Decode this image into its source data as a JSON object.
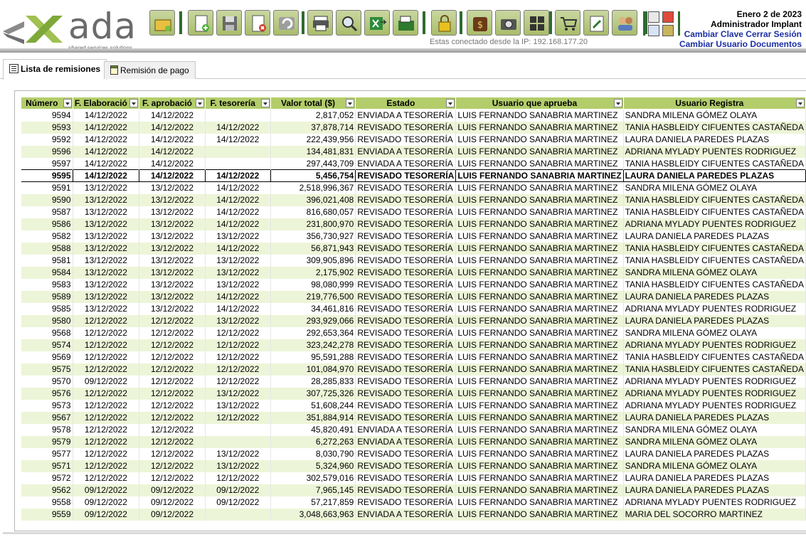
{
  "header": {
    "logo_text": "ada",
    "logo_subtitle": "shared services solutions",
    "ip_text": "Estas conectado desde la IP: 192.168.177.20",
    "date": "Enero 2 de 2023",
    "user": "Administrador Implant",
    "links": {
      "change_password": "Cambiar Clave",
      "logout": "Cerrar Sesión",
      "change_user": "Cambiar Usuario",
      "documents": "Documentos"
    },
    "toolbar_icons": [
      "open-folder-icon",
      "new-document-icon",
      "save-icon",
      "delete-icon",
      "undo-icon",
      "print-icon",
      "search-icon",
      "export-excel-icon",
      "send-icon",
      "lock-icon",
      "money-bag-icon",
      "camera-icon",
      "grid-icon",
      "cart-icon",
      "edit-icon",
      "users-icon"
    ],
    "colors": {
      "accent_green": "#b3cd6a",
      "row_alt": "#edf5d8",
      "link_blue": "#1b2fa3",
      "separator": "#2f6b2f"
    }
  },
  "tabs": [
    {
      "label": "Lista de remisiones",
      "active": true
    },
    {
      "label": "Remisión de pago",
      "active": false
    }
  ],
  "grid": {
    "columns": [
      "Número",
      "F. Elaboració",
      "F. aprobació",
      "F. tesorería",
      "Valor total ($)",
      "Estado",
      "Usuario que aprueba",
      "Usuario Registra"
    ],
    "selected_row": 5,
    "rows": [
      [
        "9594",
        "14/12/2022",
        "14/12/2022",
        "",
        "2,817,052",
        "ENVIADA A TESORERÍA",
        "LUIS FERNANDO SANABRIA MARTINEZ",
        "SANDRA MILENA GÓMEZ OLAYA"
      ],
      [
        "9593",
        "14/12/2022",
        "14/12/2022",
        "14/12/2022",
        "37,878,714",
        "REVISADO TESORERÍA",
        "LUIS FERNANDO SANABRIA MARTINEZ",
        "TANIA HASBLEIDY CIFUENTES CASTAÑEDA"
      ],
      [
        "9592",
        "14/12/2022",
        "14/12/2022",
        "14/12/2022",
        "222,439,956",
        "REVISADO TESORERÍA",
        "LUIS FERNANDO SANABRIA MARTINEZ",
        "LAURA DANIELA PAREDES PLAZAS"
      ],
      [
        "9596",
        "14/12/2022",
        "14/12/2022",
        "",
        "134,481,831",
        "ENVIADA A TESORERÍA",
        "LUIS FERNANDO SANABRIA MARTINEZ",
        "ADRIANA MYLADY PUENTES RODRIGUEZ"
      ],
      [
        "9597",
        "14/12/2022",
        "14/12/2022",
        "",
        "297,443,709",
        "ENVIADA A TESORERÍA",
        "LUIS FERNANDO SANABRIA MARTINEZ",
        "TANIA HASBLEIDY CIFUENTES CASTAÑEDA"
      ],
      [
        "9595",
        "14/12/2022",
        "14/12/2022",
        "14/12/2022",
        "5,456,754",
        "REVISADO TESORERÍA",
        "LUIS FERNANDO SANABRIA MARTINEZ",
        "LAURA DANIELA PAREDES PLAZAS"
      ],
      [
        "9591",
        "13/12/2022",
        "13/12/2022",
        "14/12/2022",
        "2,518,996,367",
        "REVISADO TESORERÍA",
        "LUIS FERNANDO SANABRIA MARTINEZ",
        "SANDRA MILENA GÓMEZ OLAYA"
      ],
      [
        "9590",
        "13/12/2022",
        "13/12/2022",
        "14/12/2022",
        "396,021,408",
        "REVISADO TESORERÍA",
        "LUIS FERNANDO SANABRIA MARTINEZ",
        "TANIA HASBLEIDY CIFUENTES CASTAÑEDA"
      ],
      [
        "9587",
        "13/12/2022",
        "13/12/2022",
        "14/12/2022",
        "816,680,057",
        "REVISADO TESORERÍA",
        "LUIS FERNANDO SANABRIA MARTINEZ",
        "TANIA HASBLEIDY CIFUENTES CASTAÑEDA"
      ],
      [
        "9586",
        "13/12/2022",
        "13/12/2022",
        "14/12/2022",
        "231,800,970",
        "REVISADO TESORERÍA",
        "LUIS FERNANDO SANABRIA MARTINEZ",
        "ADRIANA MYLADY PUENTES RODRIGUEZ"
      ],
      [
        "9582",
        "13/12/2022",
        "13/12/2022",
        "13/12/2022",
        "356,730,927",
        "REVISADO TESORERÍA",
        "LUIS FERNANDO SANABRIA MARTINEZ",
        "LAURA DANIELA PAREDES PLAZAS"
      ],
      [
        "9588",
        "13/12/2022",
        "13/12/2022",
        "14/12/2022",
        "56,871,943",
        "REVISADO TESORERÍA",
        "LUIS FERNANDO SANABRIA MARTINEZ",
        "TANIA HASBLEIDY CIFUENTES CASTAÑEDA"
      ],
      [
        "9581",
        "13/12/2022",
        "13/12/2022",
        "13/12/2022",
        "309,905,896",
        "REVISADO TESORERÍA",
        "LUIS FERNANDO SANABRIA MARTINEZ",
        "TANIA HASBLEIDY CIFUENTES CASTAÑEDA"
      ],
      [
        "9584",
        "13/12/2022",
        "13/12/2022",
        "13/12/2022",
        "2,175,902",
        "REVISADO TESORERÍA",
        "LUIS FERNANDO SANABRIA MARTINEZ",
        "SANDRA MILENA GÓMEZ OLAYA"
      ],
      [
        "9583",
        "13/12/2022",
        "13/12/2022",
        "13/12/2022",
        "98,080,999",
        "REVISADO TESORERÍA",
        "LUIS FERNANDO SANABRIA MARTINEZ",
        "TANIA HASBLEIDY CIFUENTES CASTAÑEDA"
      ],
      [
        "9589",
        "13/12/2022",
        "13/12/2022",
        "14/12/2022",
        "219,776,500",
        "REVISADO TESORERÍA",
        "LUIS FERNANDO SANABRIA MARTINEZ",
        "LAURA DANIELA PAREDES PLAZAS"
      ],
      [
        "9585",
        "13/12/2022",
        "13/12/2022",
        "14/12/2022",
        "34,461,816",
        "REVISADO TESORERÍA",
        "LUIS FERNANDO SANABRIA MARTINEZ",
        "ADRIANA MYLADY PUENTES RODRIGUEZ"
      ],
      [
        "9580",
        "12/12/2022",
        "12/12/2022",
        "13/12/2022",
        "293,929,066",
        "REVISADO TESORERÍA",
        "LUIS FERNANDO SANABRIA MARTINEZ",
        "LAURA DANIELA PAREDES PLAZAS"
      ],
      [
        "9568",
        "12/12/2022",
        "12/12/2022",
        "12/12/2022",
        "292,653,364",
        "REVISADO TESORERÍA",
        "LUIS FERNANDO SANABRIA MARTINEZ",
        "SANDRA MILENA GÓMEZ OLAYA"
      ],
      [
        "9574",
        "12/12/2022",
        "12/12/2022",
        "12/12/2022",
        "323,242,278",
        "REVISADO TESORERÍA",
        "LUIS FERNANDO SANABRIA MARTINEZ",
        "ADRIANA MYLADY PUENTES RODRIGUEZ"
      ],
      [
        "9569",
        "12/12/2022",
        "12/12/2022",
        "12/12/2022",
        "95,591,288",
        "REVISADO TESORERÍA",
        "LUIS FERNANDO SANABRIA MARTINEZ",
        "TANIA HASBLEIDY CIFUENTES CASTAÑEDA"
      ],
      [
        "9575",
        "12/12/2022",
        "12/12/2022",
        "12/12/2022",
        "101,084,970",
        "REVISADO TESORERÍA",
        "LUIS FERNANDO SANABRIA MARTINEZ",
        "TANIA HASBLEIDY CIFUENTES CASTAÑEDA"
      ],
      [
        "9570",
        "09/12/2022",
        "12/12/2022",
        "12/12/2022",
        "28,285,833",
        "REVISADO TESORERÍA",
        "LUIS FERNANDO SANABRIA MARTINEZ",
        "ADRIANA MYLADY PUENTES RODRIGUEZ"
      ],
      [
        "9576",
        "12/12/2022",
        "12/12/2022",
        "13/12/2022",
        "307,725,326",
        "REVISADO TESORERÍA",
        "LUIS FERNANDO SANABRIA MARTINEZ",
        "ADRIANA MYLADY PUENTES RODRIGUEZ"
      ],
      [
        "9573",
        "12/12/2022",
        "12/12/2022",
        "13/12/2022",
        "51,608,244",
        "REVISADO TESORERÍA",
        "LUIS FERNANDO SANABRIA MARTINEZ",
        "ADRIANA MYLADY PUENTES RODRIGUEZ"
      ],
      [
        "9567",
        "12/12/2022",
        "12/12/2022",
        "12/12/2022",
        "351,884,914",
        "REVISADO TESORERÍA",
        "LUIS FERNANDO SANABRIA MARTINEZ",
        "LAURA DANIELA PAREDES PLAZAS"
      ],
      [
        "9578",
        "12/12/2022",
        "12/12/2022",
        "",
        "45,820,491",
        "ENVIADA A TESORERÍA",
        "LUIS FERNANDO SANABRIA MARTINEZ",
        "SANDRA MILENA GÓMEZ OLAYA"
      ],
      [
        "9579",
        "12/12/2022",
        "12/12/2022",
        "",
        "6,272,263",
        "ENVIADA A TESORERÍA",
        "LUIS FERNANDO SANABRIA MARTINEZ",
        "SANDRA MILENA GÓMEZ OLAYA"
      ],
      [
        "9577",
        "12/12/2022",
        "12/12/2022",
        "13/12/2022",
        "8,030,790",
        "REVISADO TESORERÍA",
        "LUIS FERNANDO SANABRIA MARTINEZ",
        "LAURA DANIELA PAREDES PLAZAS"
      ],
      [
        "9571",
        "12/12/2022",
        "12/12/2022",
        "13/12/2022",
        "5,324,960",
        "REVISADO TESORERÍA",
        "LUIS FERNANDO SANABRIA MARTINEZ",
        "SANDRA MILENA GÓMEZ OLAYA"
      ],
      [
        "9572",
        "12/12/2022",
        "12/12/2022",
        "12/12/2022",
        "302,579,016",
        "REVISADO TESORERÍA",
        "LUIS FERNANDO SANABRIA MARTINEZ",
        "LAURA DANIELA PAREDES PLAZAS"
      ],
      [
        "9562",
        "09/12/2022",
        "09/12/2022",
        "09/12/2022",
        "7,965,145",
        "REVISADO TESORERÍA",
        "LUIS FERNANDO SANABRIA MARTINEZ",
        "LAURA DANIELA PAREDES PLAZAS"
      ],
      [
        "9558",
        "09/12/2022",
        "09/12/2022",
        "09/12/2022",
        "57,217,859",
        "REVISADO TESORERÍA",
        "LUIS FERNANDO SANABRIA MARTINEZ",
        "ADRIANA MYLADY PUENTES RODRIGUEZ"
      ],
      [
        "9559",
        "09/12/2022",
        "09/12/2022",
        "",
        "3,048,663,963",
        "ENVIADA A TESORERÍA",
        "LUIS FERNANDO SANABRIA MARTINEZ",
        "MARIA DEL SOCORRO MARTINEZ"
      ]
    ]
  }
}
